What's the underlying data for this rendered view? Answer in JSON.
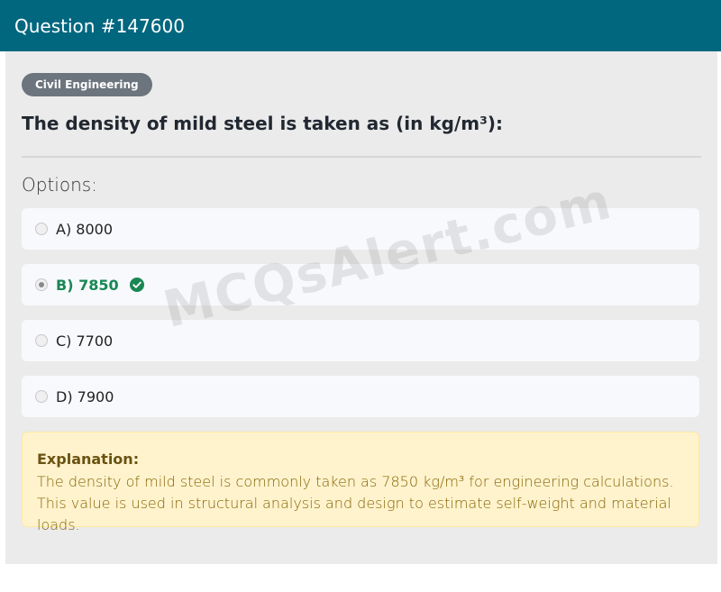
{
  "header": {
    "title": "Question #147600"
  },
  "category": {
    "label": "Civil Engineering"
  },
  "question": {
    "text": "The density of mild steel is taken as (in kg/m³):"
  },
  "options": {
    "label": "Options:",
    "items": [
      {
        "text": "A) 8000",
        "selected": false,
        "correct": false
      },
      {
        "text": "B) 7850",
        "selected": true,
        "correct": true
      },
      {
        "text": "C) 7700",
        "selected": false,
        "correct": false
      },
      {
        "text": "D) 7900",
        "selected": false,
        "correct": false
      }
    ]
  },
  "explanation": {
    "title": "Explanation:",
    "text": "The density of mild steel is commonly taken as 7850 kg/m³ for engineering calculations. This value is used in structural analysis and design to estimate self-weight and material loads."
  },
  "watermark": {
    "text": "MCQsAlert.com"
  },
  "colors": {
    "header": "#00677f",
    "correct": "#198754",
    "explanation_bg": "#fff3cd"
  }
}
